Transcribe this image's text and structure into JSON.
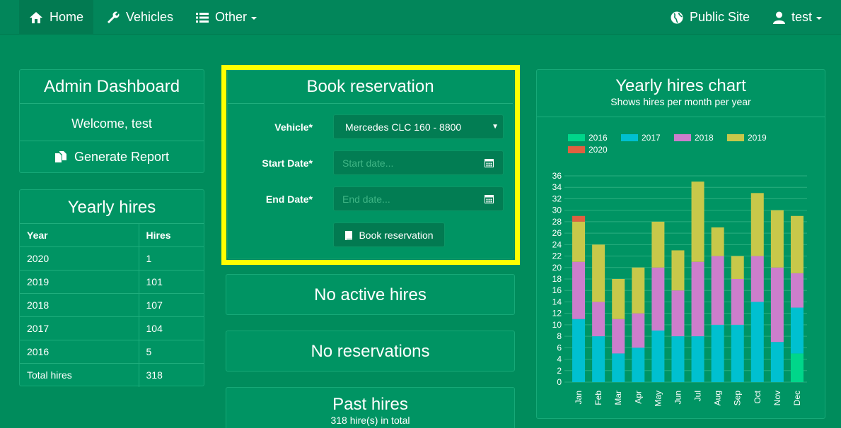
{
  "nav": {
    "home": "Home",
    "vehicles": "Vehicles",
    "other": "Other",
    "public_site": "Public Site",
    "user": "test"
  },
  "admin": {
    "title": "Admin Dashboard",
    "welcome": "Welcome, test",
    "report_button": "Generate Report"
  },
  "yearly_hires": {
    "title": "Yearly hires",
    "headers": [
      "Year",
      "Hires"
    ],
    "rows": [
      [
        "2020",
        "1"
      ],
      [
        "2019",
        "101"
      ],
      [
        "2018",
        "107"
      ],
      [
        "2017",
        "104"
      ],
      [
        "2016",
        "5"
      ],
      [
        "Total hires",
        "318"
      ]
    ]
  },
  "booking": {
    "title": "Book reservation",
    "vehicle_label": "Vehicle*",
    "vehicle_value": "Mercedes CLC 160 - 8800",
    "start_label": "Start Date*",
    "start_placeholder": "Start date...",
    "end_label": "End Date*",
    "end_placeholder": "End date...",
    "submit": "Book reservation"
  },
  "active_hires": {
    "title": "No active hires"
  },
  "reservations": {
    "title": "No reservations"
  },
  "past_hires": {
    "title": "Past hires",
    "subtitle": "318 hire(s) in total"
  },
  "chart_panel": {
    "title": "Yearly hires chart",
    "subtitle": "Shows hires per month per year"
  },
  "chart_data": {
    "type": "bar",
    "stacked": true,
    "categories": [
      "Jan",
      "Feb",
      "Mar",
      "Apr",
      "May",
      "Jun",
      "Jul",
      "Aug",
      "Sep",
      "Oct",
      "Nov",
      "Dec"
    ],
    "series": [
      {
        "name": "2016",
        "color": "#00d68a",
        "values": [
          0,
          0,
          0,
          0,
          0,
          0,
          0,
          0,
          0,
          0,
          0,
          5
        ]
      },
      {
        "name": "2017",
        "color": "#00c0d0",
        "values": [
          11,
          8,
          5,
          6,
          9,
          8,
          8,
          10,
          10,
          14,
          7,
          8
        ]
      },
      {
        "name": "2018",
        "color": "#cc7ecc",
        "values": [
          10,
          6,
          6,
          6,
          11,
          8,
          13,
          12,
          8,
          8,
          13,
          6
        ]
      },
      {
        "name": "2019",
        "color": "#c8c84a",
        "values": [
          7,
          10,
          7,
          8,
          8,
          7,
          14,
          5,
          4,
          11,
          10,
          10
        ]
      },
      {
        "name": "2020",
        "color": "#e06040",
        "values": [
          1,
          0,
          0,
          0,
          0,
          0,
          0,
          0,
          0,
          0,
          0,
          0
        ]
      }
    ],
    "ylim": [
      0,
      36
    ],
    "yticks": [
      0,
      2,
      4,
      6,
      8,
      10,
      12,
      14,
      16,
      18,
      20,
      22,
      24,
      26,
      28,
      30,
      32,
      34,
      36
    ],
    "legend": "top",
    "grid": true
  }
}
